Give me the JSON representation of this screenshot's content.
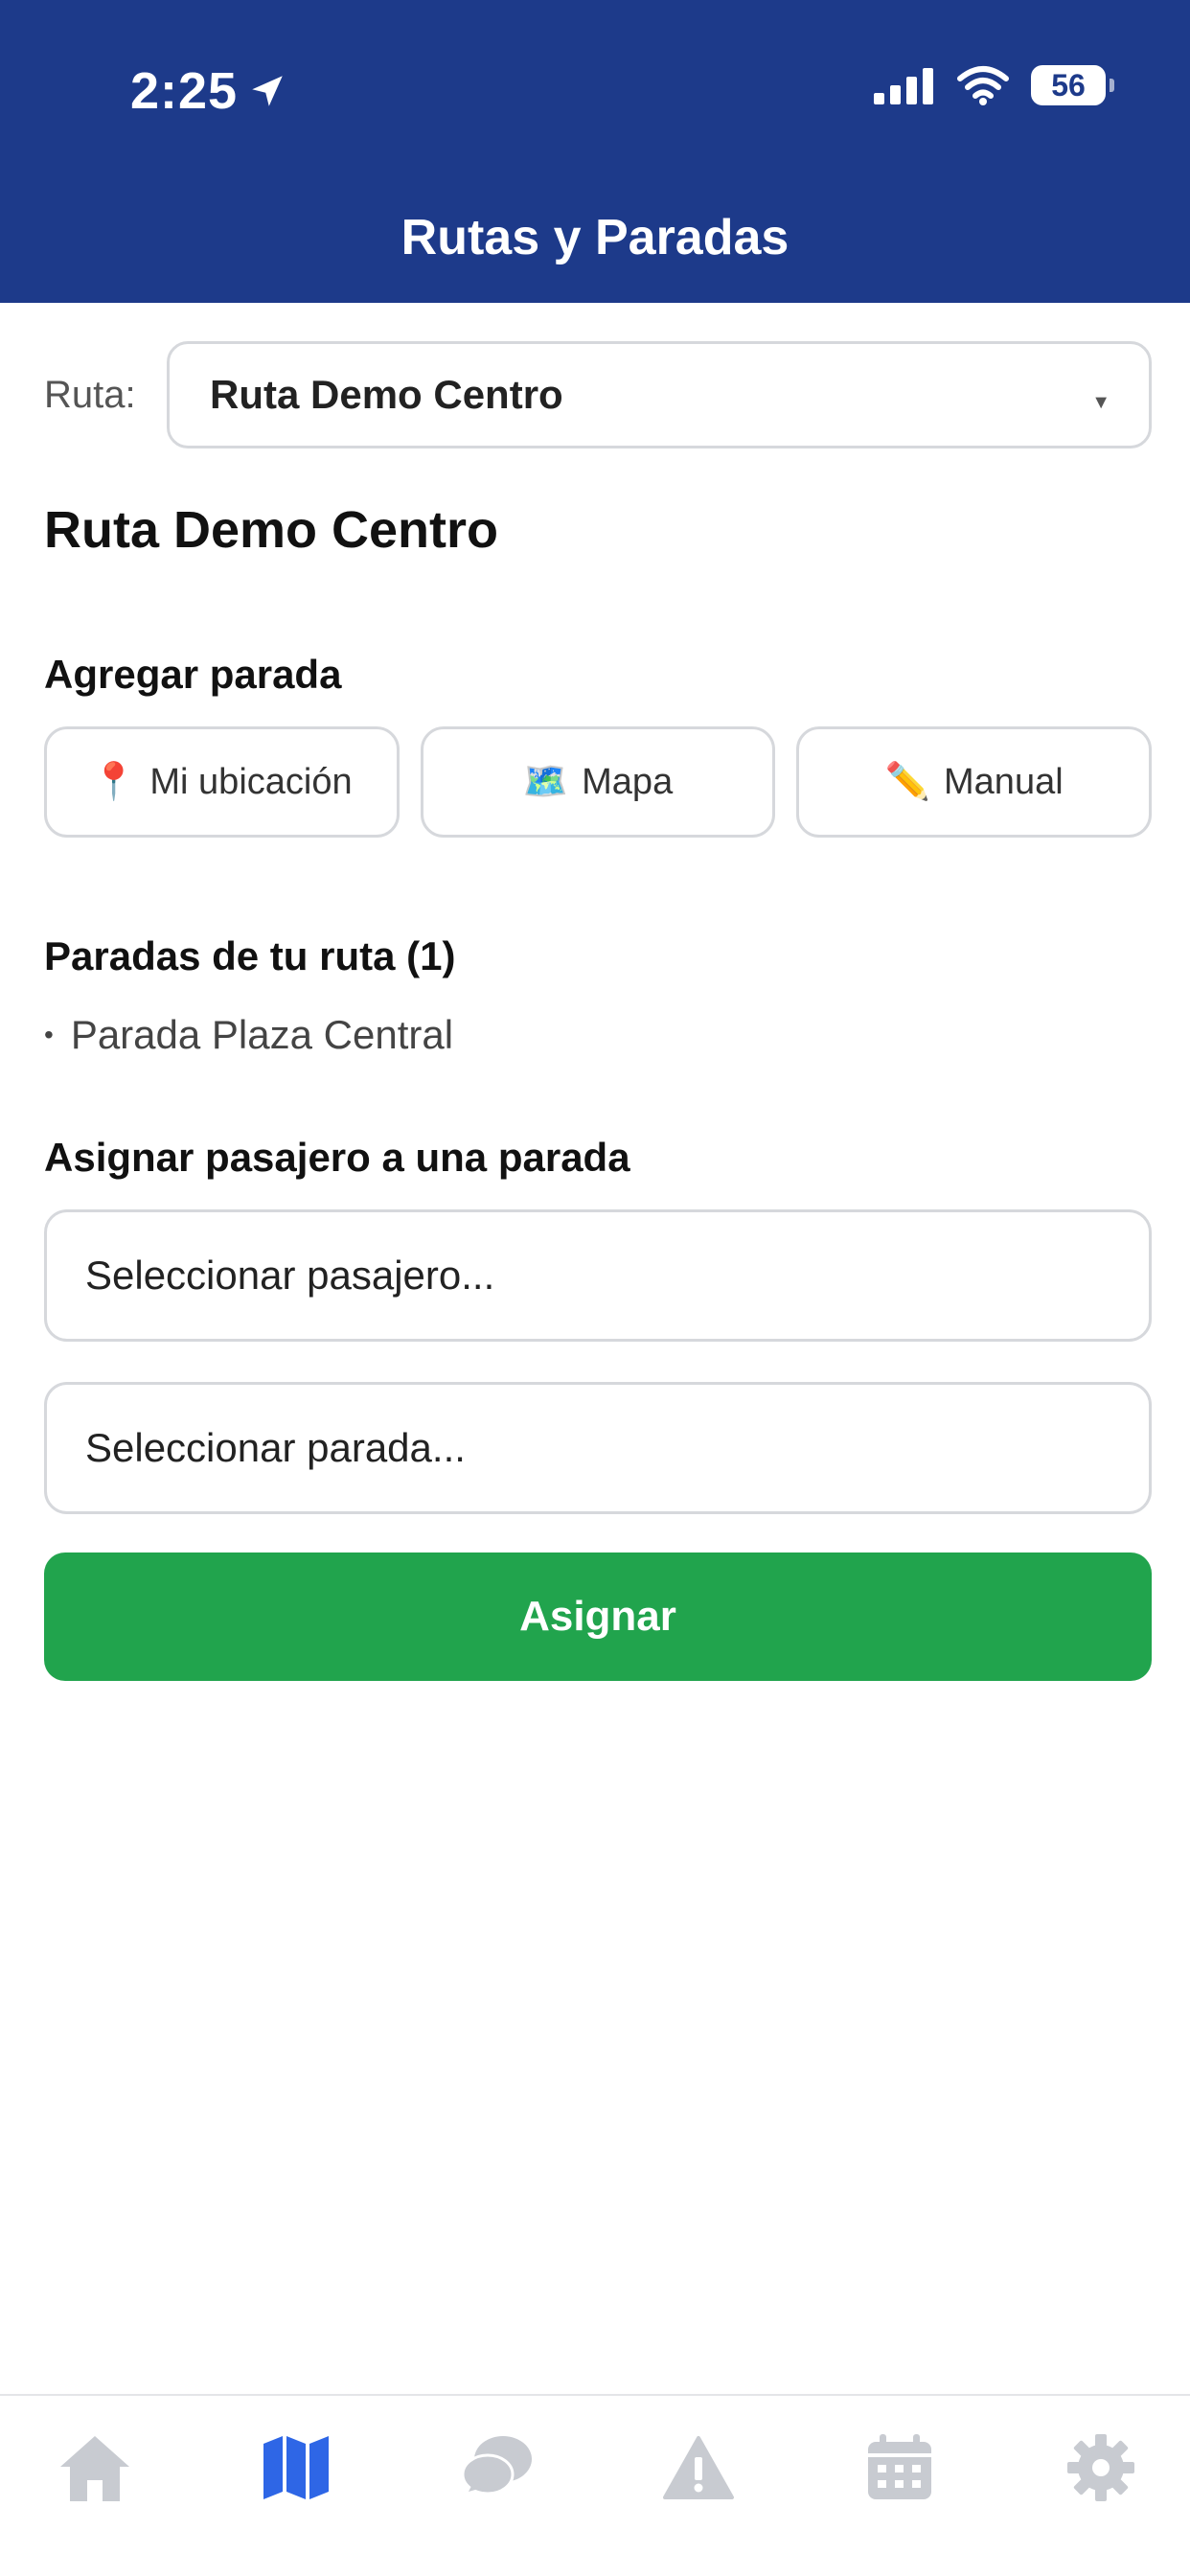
{
  "status_bar": {
    "time": "2:25",
    "battery": "56"
  },
  "header": {
    "title": "Rutas y Paradas"
  },
  "route": {
    "label": "Ruta:",
    "selected": "Ruta Demo Centro"
  },
  "route_title": "Ruta Demo Centro",
  "add_stop": {
    "heading": "Agregar parada",
    "buttons": [
      {
        "icon": "📍",
        "label": "Mi ubicación"
      },
      {
        "icon": "🗺️",
        "label": "Mapa"
      },
      {
        "icon": "✏️",
        "label": "Manual"
      }
    ]
  },
  "stops": {
    "heading": "Paradas de tu ruta (1)",
    "items": [
      "Parada Plaza Central"
    ]
  },
  "assign": {
    "heading": "Asignar pasajero a una parada",
    "passenger_placeholder": "Seleccionar pasajero...",
    "stop_placeholder": "Seleccionar parada...",
    "button": "Asignar"
  },
  "tabbar": {
    "items": [
      "home-icon",
      "map-icon",
      "chat-icon",
      "alert-icon",
      "calendar-icon",
      "settings-icon"
    ],
    "active": "map-icon",
    "active_color": "#2e66e6",
    "inactive_color": "#c8cbd1"
  },
  "colors": {
    "header": "#1d3a8a",
    "primary_button": "#21a44d"
  }
}
